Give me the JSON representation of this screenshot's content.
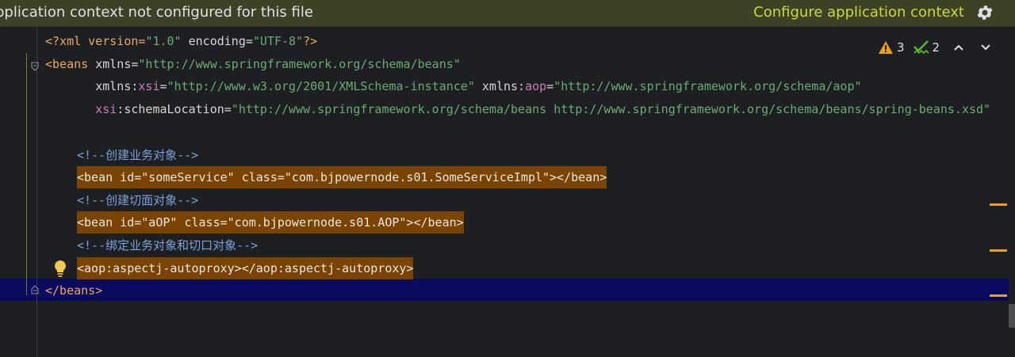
{
  "banner": {
    "message": "pplication context not configured for this file",
    "action": "Configure application context",
    "settings_icon": "gear-icon"
  },
  "inspections": {
    "warnings": "3",
    "weak_warnings": "2",
    "warning_icon": "warning-triangle-icon",
    "weak_warning_icon": "double-check-icon",
    "up_icon": "chevron-up-icon",
    "down_icon": "chevron-down-icon"
  },
  "code": {
    "l1": {
      "p1": "<?xml version=",
      "p2": "\"1.0\"",
      "p3": " encoding=",
      "p4": "\"UTF-8\"",
      "p5": "?>"
    },
    "l2": {
      "p1": "<beans",
      "p2": " xmlns=",
      "p3": "\"http://www.springframework.org/schema/beans\""
    },
    "l3": {
      "p1": "       xmlns:",
      "p2": "xsi",
      "p3": "=",
      "p4": "\"http://www.w3.org/2001/XMLSchema-instance\"",
      "p5": " xmlns:",
      "p6": "aop",
      "p7": "=",
      "p8": "\"http://www.springframework.org/schema/aop\""
    },
    "l4": {
      "p1": "       ",
      "p2": "xsi",
      "p3": ":schemaLocation=",
      "p4": "\"http://www.springframework.org/schema/beans http://www.springframework.org/schema/beans/spring-beans.xsd\""
    },
    "l6": "<!--创建业务对象-->",
    "l7": "<bean id=\"someService\" class=\"com.bjpowernode.s01.SomeServiceImpl\"></bean>",
    "l8": "<!--创建切面对象-->",
    "l9": "<bean id=\"aOP\" class=\"com.bjpowernode.s01.AOP\"></bean>",
    "l10": "<!--绑定业务对象和切口对象-->",
    "l11": "<aop:aspectj-autoproxy></aop:aspectj-autoproxy>",
    "l12": "</beans>"
  },
  "colors": {
    "banner_bg": "#3e4126",
    "link": "#cbd83a",
    "highlight": "#7a4300",
    "caret_row": "#0a0a5e",
    "warning": "#e5a11f",
    "weak_warning": "#5fb832"
  }
}
